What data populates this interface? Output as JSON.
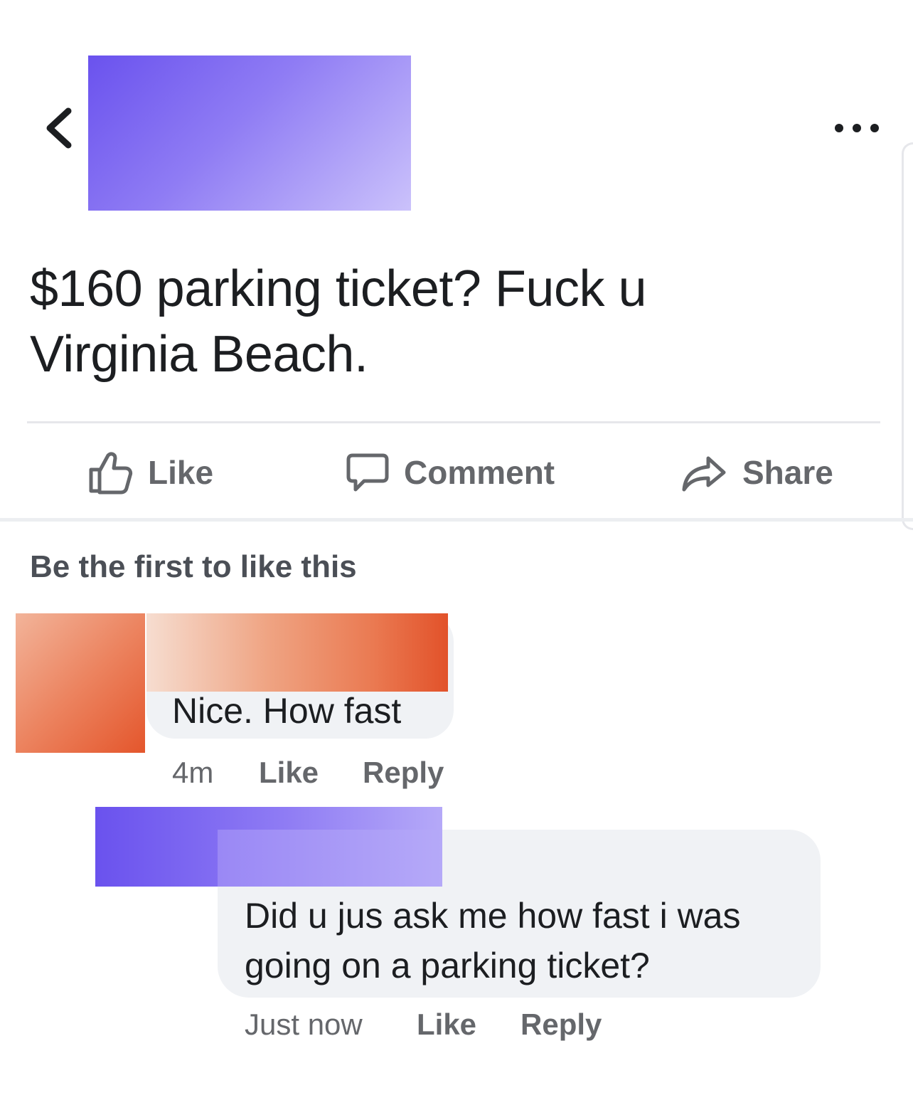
{
  "header": {
    "back_icon": "chevron-left-icon",
    "more_icon": "more-horizontal-icon"
  },
  "post": {
    "text_line1": "$160 parking ticket? Fuck u",
    "text_line2": "Virginia Beach."
  },
  "actions": {
    "like": {
      "label": "Like",
      "icon": "thumbs-up-icon"
    },
    "comment": {
      "label": "Comment",
      "icon": "comment-icon"
    },
    "share": {
      "label": "Share",
      "icon": "share-icon"
    }
  },
  "reactions": {
    "summary": "Be the first to like this"
  },
  "comments": [
    {
      "text": "Nice. How fast",
      "time": "4m",
      "like_label": "Like",
      "reply_label": "Reply"
    },
    {
      "text_line1": "Did u jus ask me how fast i was",
      "text_line2": "going on a parking ticket?",
      "time": "Just now",
      "like_label": "Like",
      "reply_label": "Reply"
    }
  ],
  "colors": {
    "redaction_purple": "#6a52ee",
    "redaction_orange": "#e4562c",
    "action_gray": "#65676b",
    "bubble_bg": "#f0f2f5"
  }
}
